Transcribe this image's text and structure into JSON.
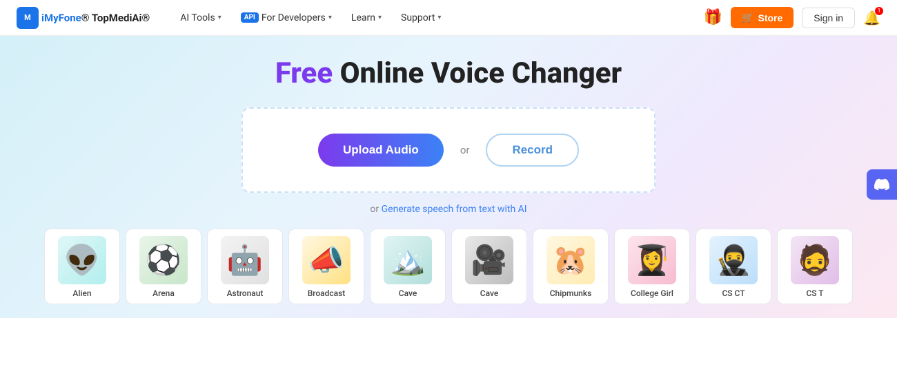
{
  "navbar": {
    "logo_brand": "iMyFone",
    "logo_product": "TopMediAi",
    "logo_trademark": "®",
    "nav_items": [
      {
        "id": "ai-tools",
        "label": "AI Tools",
        "has_arrow": true,
        "api_badge": false
      },
      {
        "id": "for-developers",
        "label": "For Developers",
        "has_arrow": true,
        "api_badge": true
      },
      {
        "id": "learn",
        "label": "Learn",
        "has_arrow": true,
        "api_badge": false
      },
      {
        "id": "support",
        "label": "Support",
        "has_arrow": true,
        "api_badge": false
      }
    ],
    "store_label": "Store",
    "signin_label": "Sign in"
  },
  "hero": {
    "title_free": "Free",
    "title_rest": " Online Voice Changer",
    "upload_label": "Upload Audio",
    "or_text": "or",
    "record_label": "Record",
    "generate_prefix": "or ",
    "generate_link_text": "Generate speech from text with AI"
  },
  "voice_cards": [
    {
      "id": "alien",
      "label": "Alien",
      "emoji": "👽",
      "style": "alien-icon"
    },
    {
      "id": "arena",
      "label": "Arena",
      "emoji": "⚽",
      "style": "arena-icon"
    },
    {
      "id": "astronaut",
      "label": "Astronaut",
      "emoji": "🤖",
      "style": "astronaut-icon"
    },
    {
      "id": "broadcast",
      "label": "Broadcast",
      "emoji": "📣",
      "style": "broadcast-icon"
    },
    {
      "id": "cave-teal",
      "label": "Cave",
      "emoji": "🏔️",
      "style": "cave-teal-icon"
    },
    {
      "id": "cave-dark",
      "label": "Cave",
      "emoji": "🎥",
      "style": "cave-dark-icon"
    },
    {
      "id": "chipmunks",
      "label": "Chipmunks",
      "emoji": "🐹",
      "style": "chipmunks-icon"
    },
    {
      "id": "college-girl",
      "label": "College Girl",
      "emoji": "👩‍🎓",
      "style": "college-girl-icon"
    },
    {
      "id": "csct",
      "label": "CS CT",
      "emoji": "🥷",
      "style": "csct-icon"
    },
    {
      "id": "cst",
      "label": "CS T",
      "emoji": "🧔",
      "style": "cst-icon"
    }
  ],
  "discord": {
    "icon": "💬"
  }
}
